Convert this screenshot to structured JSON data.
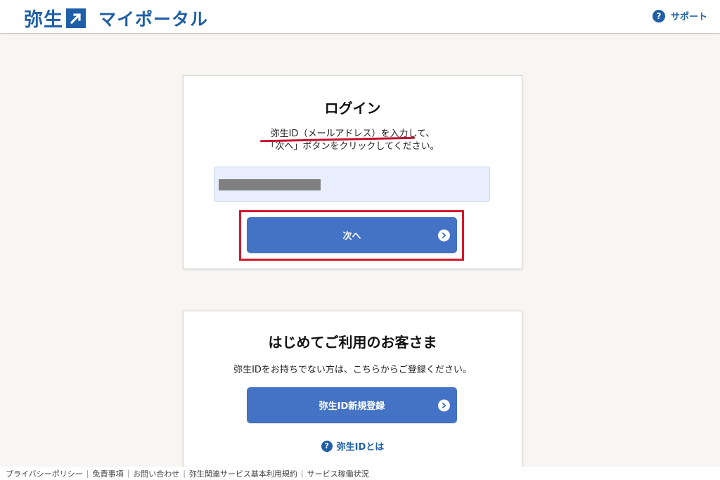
{
  "header": {
    "brand": "弥生",
    "title": "マイポータル",
    "support_label": "サポート",
    "support_icon": "question-circle-icon"
  },
  "login": {
    "title": "ログイン",
    "instruction_line1": "弥生ID（メールアドレス）を入力して、",
    "instruction_line2": "「次へ」ボタンをクリックしてください。",
    "input_value": "",
    "next_button": "次へ",
    "next_icon": "arrow-right-circle-icon"
  },
  "new_user": {
    "title": "はじめてご利用のお客さま",
    "description": "弥生IDをお持ちでない方は、こちらからご登録ください。",
    "register_button": "弥生ID新規登録",
    "register_icon": "arrow-right-circle-icon",
    "help_link": "弥生IDとは",
    "help_icon": "question-circle-icon"
  },
  "footer": {
    "links": [
      "プライバシーポリシー",
      "免責事項",
      "お問い合わせ",
      "弥生関連サービス基本利用規約",
      "サービス稼働状況"
    ]
  },
  "colors": {
    "brand_blue": "#1f5fa8",
    "button_blue": "#4472c4",
    "highlight_red": "#d7182a",
    "page_background": "#f8f6f3"
  }
}
